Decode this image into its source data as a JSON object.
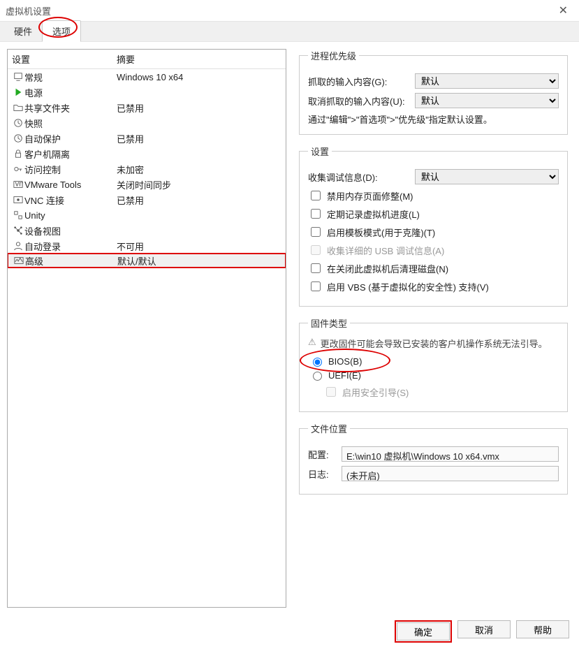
{
  "window": {
    "title": "虚拟机设置"
  },
  "tabs": {
    "hardware": "硬件",
    "options": "选项"
  },
  "list": {
    "head_setting": "设置",
    "head_summary": "摘要",
    "items": [
      {
        "label": "常规",
        "summary": "Windows 10 x64",
        "icon": "monitor"
      },
      {
        "label": "电源",
        "summary": "",
        "icon": "play"
      },
      {
        "label": "共享文件夹",
        "summary": "已禁用",
        "icon": "folder"
      },
      {
        "label": "快照",
        "summary": "",
        "icon": "clock"
      },
      {
        "label": "自动保护",
        "summary": "已禁用",
        "icon": "clock"
      },
      {
        "label": "客户机隔离",
        "summary": "",
        "icon": "lock"
      },
      {
        "label": "访问控制",
        "summary": "未加密",
        "icon": "keys"
      },
      {
        "label": "VMware Tools",
        "summary": "关闭时间同步",
        "icon": "vm"
      },
      {
        "label": "VNC 连接",
        "summary": "已禁用",
        "icon": "vnc"
      },
      {
        "label": "Unity",
        "summary": "",
        "icon": "unity"
      },
      {
        "label": "设备视图",
        "summary": "",
        "icon": "device"
      },
      {
        "label": "自动登录",
        "summary": "不可用",
        "icon": "user"
      },
      {
        "label": "高级",
        "summary": "默认/默认",
        "icon": "wave"
      }
    ]
  },
  "priority": {
    "legend": "进程优先级",
    "grabbed_label": "抓取的输入内容(G):",
    "ungrabbed_label": "取消抓取的输入内容(U):",
    "default": "默认",
    "hint": "通过\"编辑\">\"首选项\">\"优先级\"指定默认设置。"
  },
  "settings": {
    "legend": "设置",
    "debug_label": "收集调试信息(D):",
    "debug_default": "默认",
    "cb_mem": "禁用内存页面修整(M)",
    "cb_log": "定期记录虚拟机进度(L)",
    "cb_template": "启用模板模式(用于克隆)(T)",
    "cb_usb": "收集详细的 USB 调试信息(A)",
    "cb_clean": "在关闭此虚拟机后清理磁盘(N)",
    "cb_vbs": "启用 VBS (基于虚拟化的安全性) 支持(V)"
  },
  "firmware": {
    "legend": "固件类型",
    "warn": "更改固件可能会导致已安装的客户机操作系统无法引导。",
    "bios": "BIOS(B)",
    "uefi": "UEFI(E)",
    "secure_boot": "启用安全引导(S)"
  },
  "files": {
    "legend": "文件位置",
    "config_label": "配置:",
    "config_value": "E:\\win10 虚拟机\\Windows 10 x64.vmx",
    "log_label": "日志:",
    "log_value": "(未开启)"
  },
  "buttons": {
    "ok": "确定",
    "cancel": "取消",
    "help": "帮助"
  }
}
